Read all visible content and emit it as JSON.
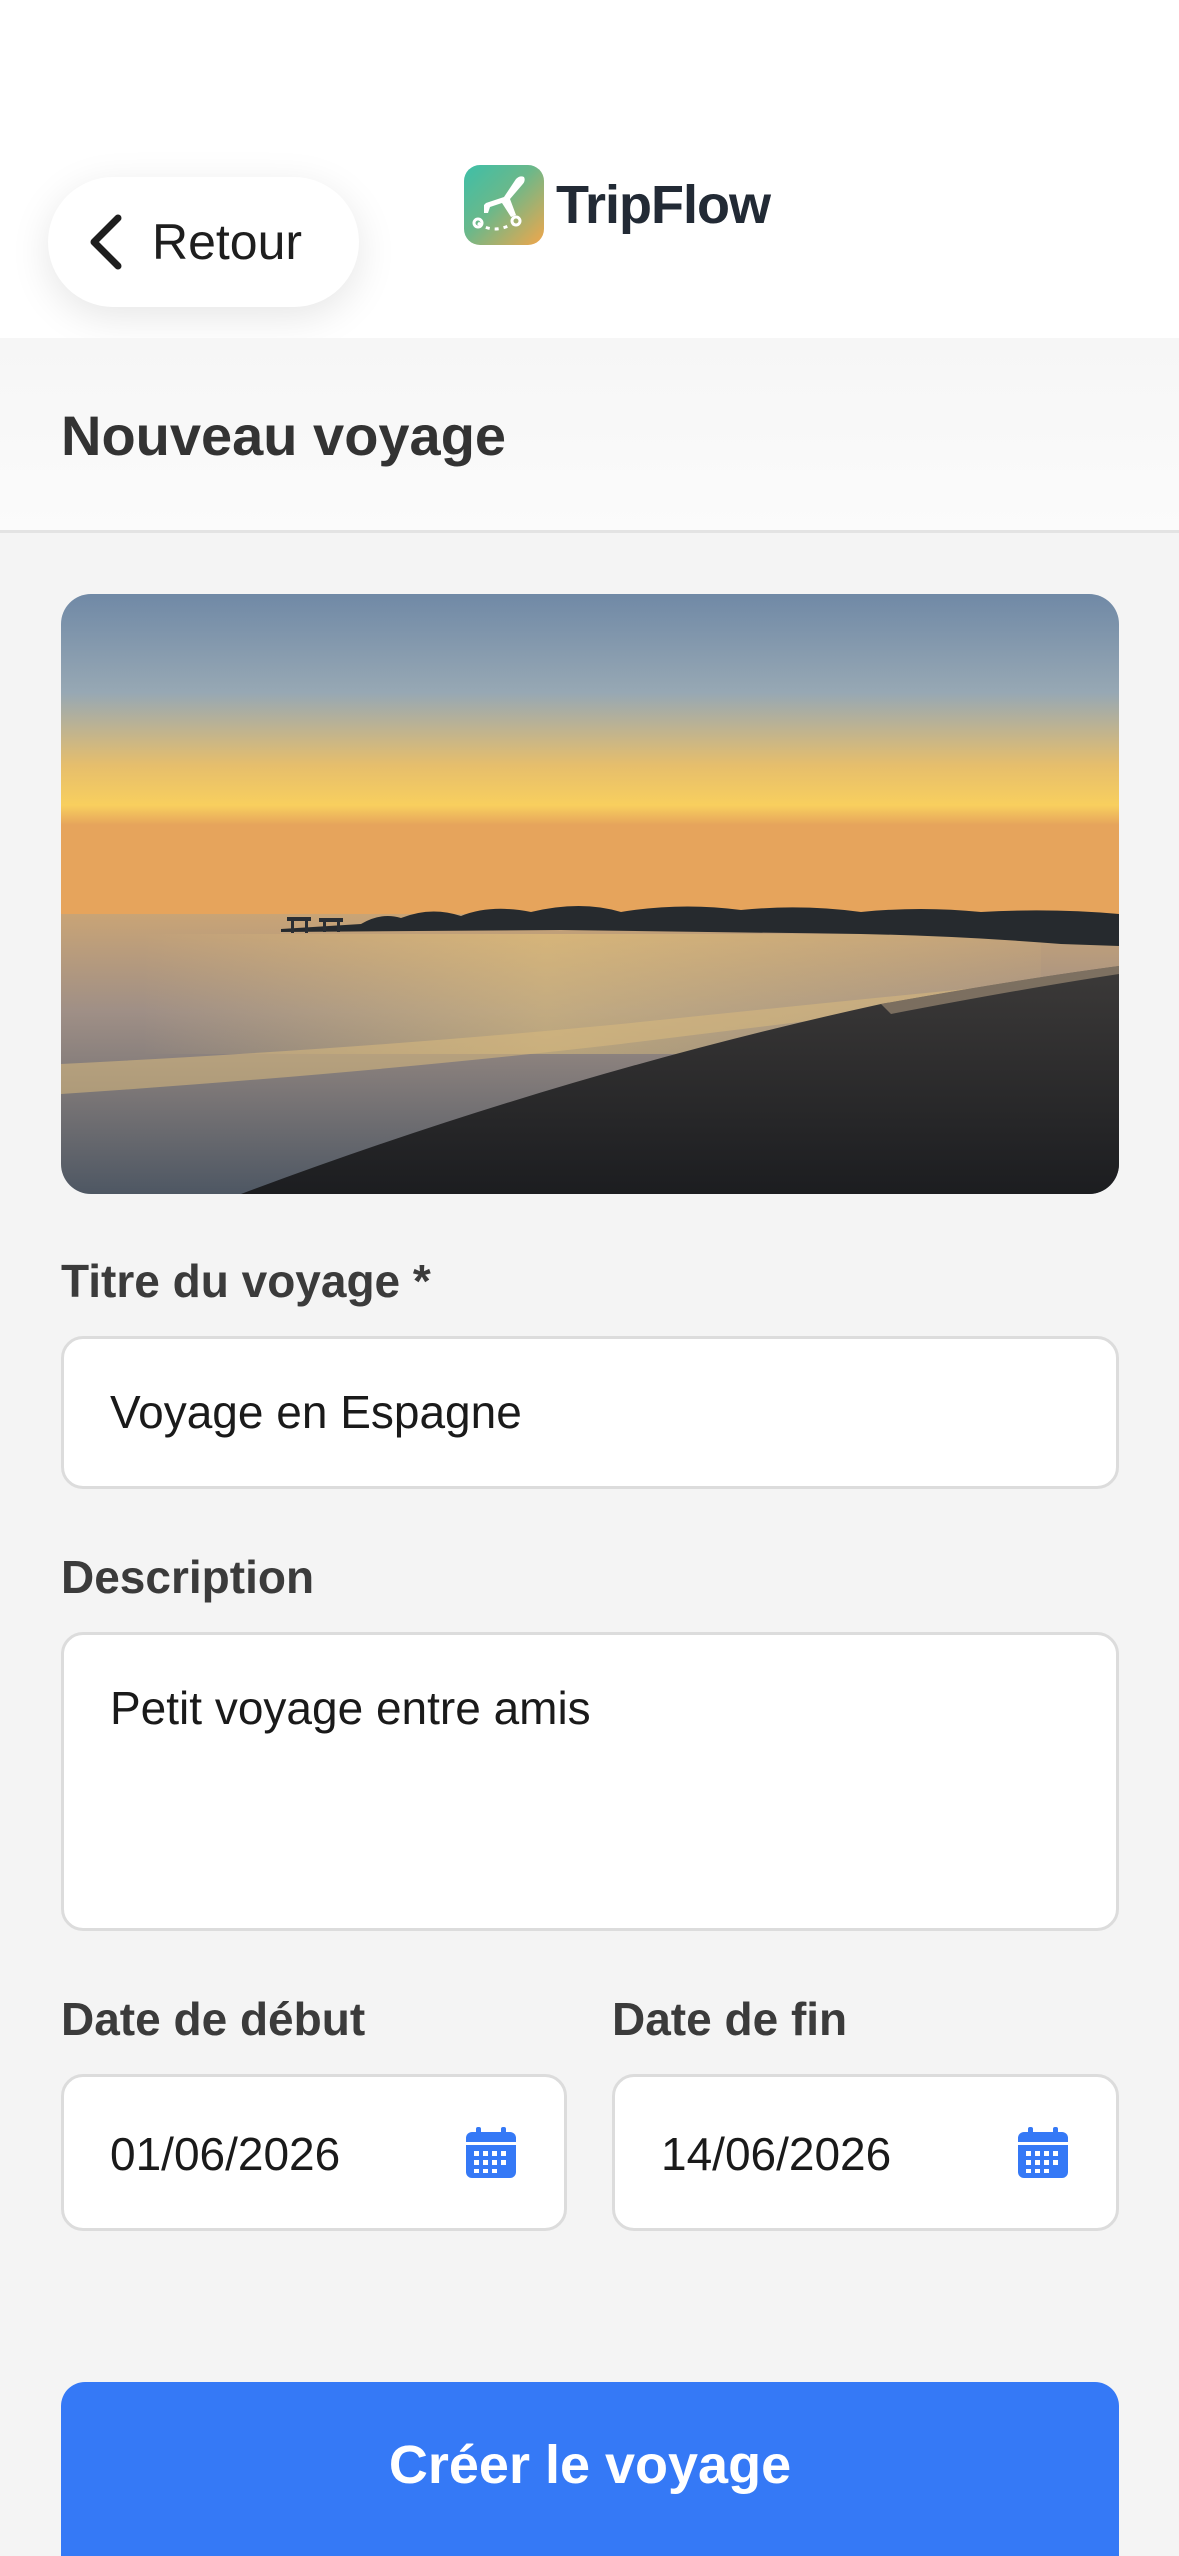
{
  "header": {
    "back_label": "Retour",
    "brand_name": "TripFlow"
  },
  "page": {
    "title": "Nouveau voyage"
  },
  "form": {
    "title_label": "Titre du voyage *",
    "title_value": "Voyage en Espagne",
    "description_label": "Description",
    "description_value": "Petit voyage entre amis",
    "start_label": "Date de début",
    "start_value": "01/06/2026",
    "end_label": "Date de fin",
    "end_value": "14/06/2026",
    "submit_label": "Créer le voyage"
  },
  "icons": {
    "back": "chevron-left-icon",
    "logo": "airplane-icon",
    "calendar": "calendar-icon"
  },
  "colors": {
    "accent": "#3579f6",
    "brand_text": "#222a35"
  }
}
